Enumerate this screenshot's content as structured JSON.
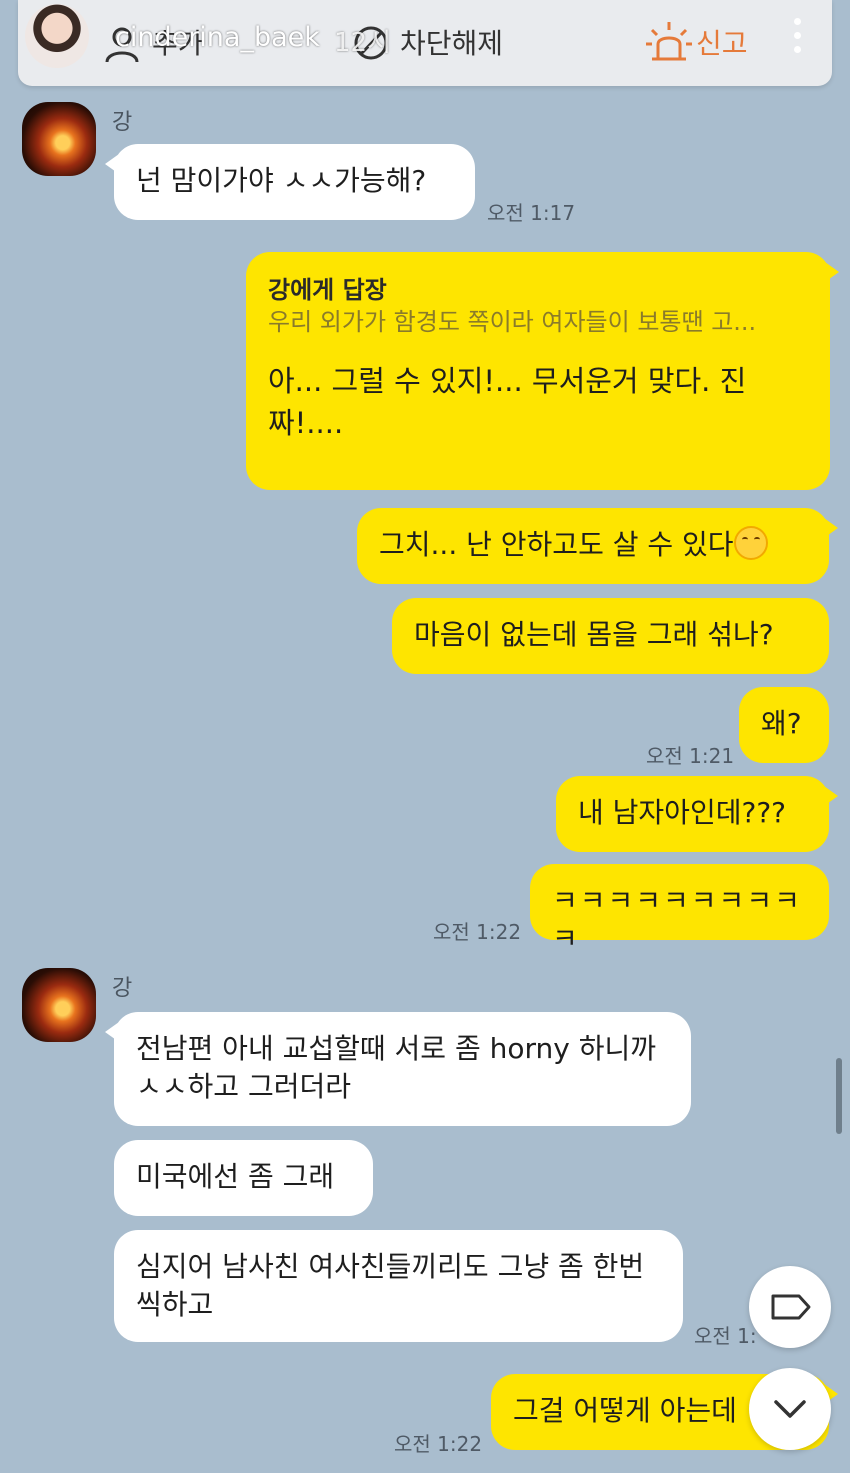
{
  "story_header": {
    "username": "cinderina_baek",
    "time_ago": "12시",
    "add_friend": "추가",
    "unblock": "차단해제",
    "report": "신고"
  },
  "messages": [
    {
      "id": "m1",
      "sender": "강",
      "text": "넌 맘이가야 ㅅㅅ가능해?",
      "time": "오전 1:17"
    },
    {
      "id": "m2",
      "reply_to": "강에게 답장",
      "quoted": "우리 외가가 함경도 쪽이라 여자들이 보통땐 고...",
      "text": "아... 그럴 수 있지!... 무서운거 맞다. 진짜!...."
    },
    {
      "id": "m3",
      "text": "그치... 난 안하고도 살 수 있다"
    },
    {
      "id": "m4",
      "text": "마음이 없는데 몸을 그래 섞나?"
    },
    {
      "id": "m5",
      "text": "왜?",
      "time": "오전 1:21"
    },
    {
      "id": "m6",
      "text": "내 남자아인데???"
    },
    {
      "id": "m7",
      "text": "ㅋㅋㅋㅋㅋㅋㅋㅋㅋㅋ",
      "time": "오전 1:22"
    },
    {
      "id": "m8",
      "sender": "강",
      "text": "전남편 아내 교섭할때 서로 좀 horny 하니까 ㅅㅅ하고 그러더라"
    },
    {
      "id": "m9",
      "text": "미국에선 좀 그래"
    },
    {
      "id": "m10",
      "text": "심지어 남사친 여사친들끼리도 그냥 좀 한번씩하고",
      "time": "오전 1:"
    },
    {
      "id": "m11",
      "text": "그걸 어떻게 아는데",
      "time": "오전 1:22"
    }
  ],
  "colors": {
    "background": "#a9bdce",
    "outgoing_bubble": "#fee500",
    "incoming_bubble": "#ffffff",
    "report_accent": "#e57a3a"
  },
  "icons": [
    "person-add-icon",
    "unblock-icon",
    "siren-icon",
    "kebab-menu-icon",
    "tag-icon",
    "chevron-down-icon",
    "smile-emoji"
  ]
}
